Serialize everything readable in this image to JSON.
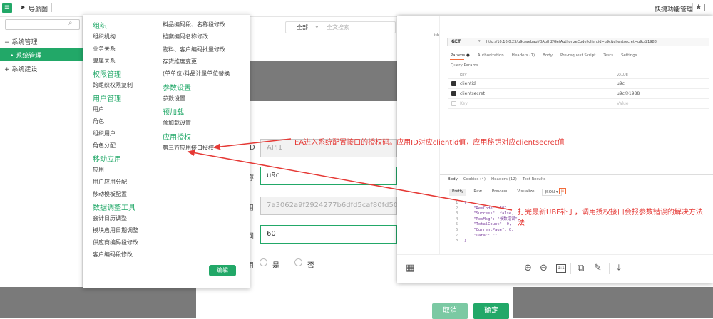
{
  "topbar": {
    "nav_label": "导航图",
    "quick_label": "快捷功能管理"
  },
  "sidebar": {
    "items": [
      {
        "label": "系统管理",
        "prefix": "−"
      },
      {
        "label": "系统管理",
        "prefix": "•"
      },
      {
        "label": "系统建设",
        "prefix": "+"
      }
    ]
  },
  "search": {
    "scope": "全部",
    "placeholder": "全文搜索"
  },
  "menu": {
    "col1": [
      {
        "text": "组织",
        "h": true
      },
      {
        "text": "组织机构"
      },
      {
        "text": "业务关系"
      },
      {
        "text": "隶属关系"
      },
      {
        "text": "权限管理",
        "h": true
      },
      {
        "text": "跨组织权限复制"
      },
      {
        "text": "用户管理",
        "h": true
      },
      {
        "text": "用户"
      },
      {
        "text": "角色"
      },
      {
        "text": "组织用户"
      },
      {
        "text": "角色分配"
      },
      {
        "text": "移动应用",
        "h": true
      },
      {
        "text": "应用"
      },
      {
        "text": "用户应用分配"
      },
      {
        "text": "移动模板配置"
      },
      {
        "text": "数据调整工具",
        "h": true
      },
      {
        "text": "会计日历调整"
      },
      {
        "text": "模块启用日期调整"
      },
      {
        "text": "供应商编码段修改"
      },
      {
        "text": "客户编码段修改"
      }
    ],
    "col2": [
      {
        "text": "料品编码段、名称段修改"
      },
      {
        "text": "档案编码名称修改"
      },
      {
        "text": "物料、客户编码批量修改"
      },
      {
        "text": "存货维度变更"
      },
      {
        "text": "(单单位)料品计量单位替换"
      },
      {
        "text": "参数设置",
        "h": true
      },
      {
        "text": "参数设置"
      },
      {
        "text": "预加载",
        "h": true
      },
      {
        "text": "预加载设置"
      },
      {
        "text": "应用授权",
        "h": true
      },
      {
        "text": "第三方应用接口授权"
      }
    ],
    "edit_button": "编辑"
  },
  "form": {
    "labels": [
      "D",
      "称",
      "用",
      "间",
      "用"
    ],
    "app_id": "API1",
    "app_name": "u9c",
    "secret": "7a3062a9f2924277b6dfd5caf80fd50d",
    "duration": "60",
    "radio_yes": "是",
    "radio_no": "否",
    "cancel": "取消",
    "confirm": "确定"
  },
  "annotations": {
    "note1": "EA进入系统配置接口的授权码。应用ID对应clientid值，应用秘钥对应clientsecret值",
    "note2_line1": "打完最新UBF补丁，调用授权接口会报参数错误的解决方法",
    "note2_line2": "法"
  },
  "postman": {
    "side_label": "ish",
    "method": "GET",
    "url": "http://10.16.0.23/u9c/webapi/OAuth2/GetAuthorizeCode?clientid=u9c&clientsecret=u9c@1988",
    "tabs": [
      "Params ●",
      "Authorization",
      "Headers (7)",
      "Body",
      "Pre-request Script",
      "Tests",
      "Settings"
    ],
    "section": "Query Params",
    "col_key": "KEY",
    "col_value": "VALUE",
    "params": [
      {
        "key": "clientid",
        "value": "u9c"
      },
      {
        "key": "clientsecret",
        "value": "u9c@1988"
      },
      {
        "key": "Key",
        "value": "Value"
      }
    ],
    "resp_tabs": [
      "Body",
      "Cookies (4)",
      "Headers (12)",
      "Test Results"
    ],
    "view_tabs": [
      "Pretty",
      "Raw",
      "Preview",
      "Visualize",
      "JSON ▾"
    ],
    "line_numbers": "1\n2\n3\n4\n5\n6\n7\n8",
    "response_code": "{\n    \"ResCode\": 502,\n    \"Success\": false,\n    \"ResMsg\": \"参数错误\",\n    \"TotalCount\": 0,\n    \"CurrentPage\": 0,\n    \"Data\": \"\"\n}"
  },
  "viewer": {
    "page_label": "1:1"
  },
  "colors": {
    "accent": "#22a868",
    "annotation": "#e53935"
  }
}
